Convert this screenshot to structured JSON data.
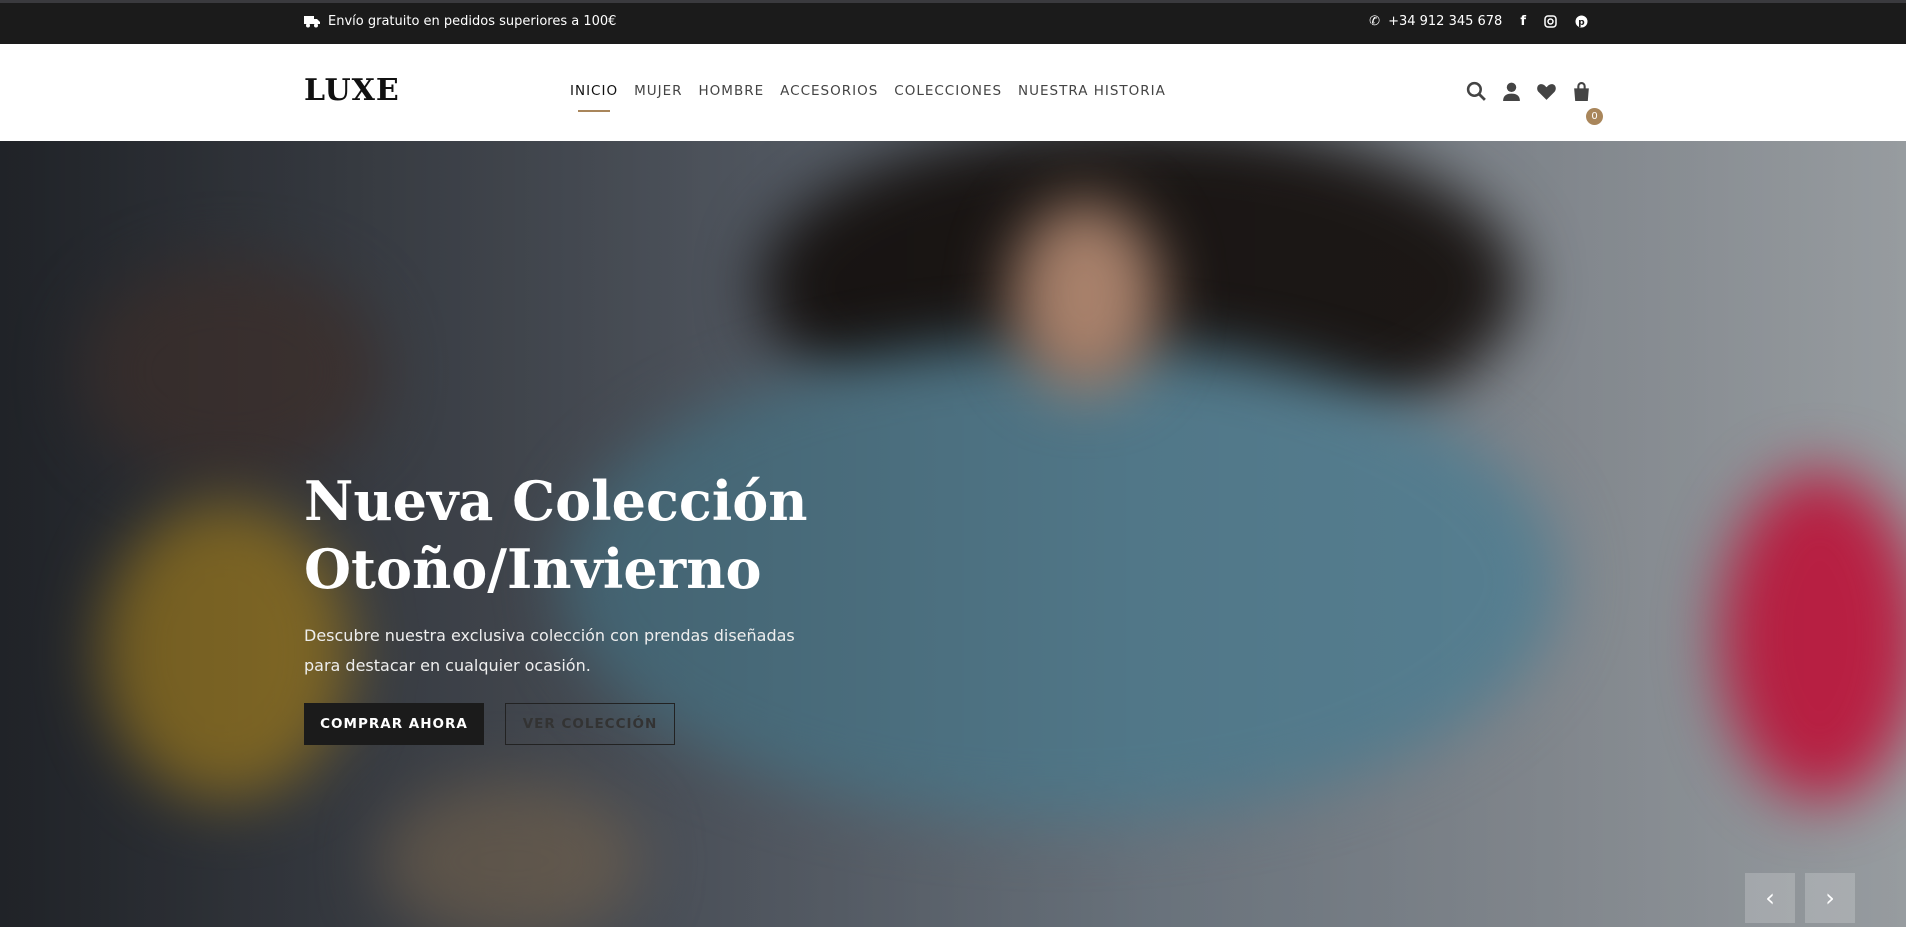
{
  "topbar": {
    "shipping_icon": "truck-icon",
    "shipping_text": "Envío gratuito en pedidos superiores a 100€",
    "phone_icon": "phone-icon",
    "phone": "+34 912 345 678",
    "social": [
      "facebook-icon",
      "instagram-icon",
      "pinterest-icon"
    ]
  },
  "header": {
    "logo": "LUXE",
    "nav": [
      {
        "label": "INICIO",
        "active": true
      },
      {
        "label": "MUJER"
      },
      {
        "label": "HOMBRE"
      },
      {
        "label": "ACCESORIOS"
      },
      {
        "label": "COLECCIONES"
      },
      {
        "label": "NUESTRA HISTORIA"
      }
    ],
    "icons": [
      "search-icon",
      "user-icon",
      "heart-icon",
      "bag-icon"
    ],
    "cart_count": "0"
  },
  "hero": {
    "title_line1": "Nueva Colección",
    "title_line2": "Otoño/Invierno",
    "description": "Descubre nuestra exclusiva colección con prendas diseñadas para destacar en cualquier ocasión.",
    "primary_button": "COMPRAR AHORA",
    "secondary_button": "VER COLECCIÓN",
    "prev": "‹",
    "next": "›"
  },
  "colors": {
    "accent": "#a9865b",
    "dark": "#1b1b1b"
  }
}
